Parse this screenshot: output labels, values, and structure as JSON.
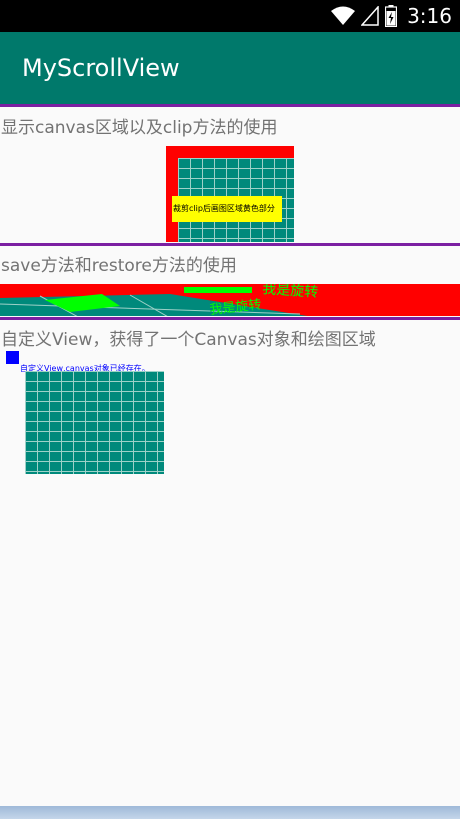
{
  "status_bar": {
    "time": "3:16",
    "icons": [
      "wifi-icon",
      "cell-signal-icon",
      "battery-icon"
    ]
  },
  "app_bar": {
    "title": "MyScrollView",
    "color": "#00796b"
  },
  "sections": [
    {
      "label": "显示canvas区域以及clip方法的使用",
      "canvas_note": "裁剪clip后画图区域黄色部分"
    },
    {
      "label": "save方法和restore方法的使用",
      "canvas_text": "我是旋转"
    },
    {
      "label": "自定义View，获得了一个Canvas对象和绘图区域",
      "canvas_caption": "自定义View,canvas对象已经存在。"
    }
  ],
  "colors": {
    "divider": "#7b1fa2",
    "canvas_background": "#ff0000",
    "grid": "#00897b",
    "highlight": "#ffff00",
    "accent_green": "#00ff00",
    "blue": "#0000ff"
  }
}
